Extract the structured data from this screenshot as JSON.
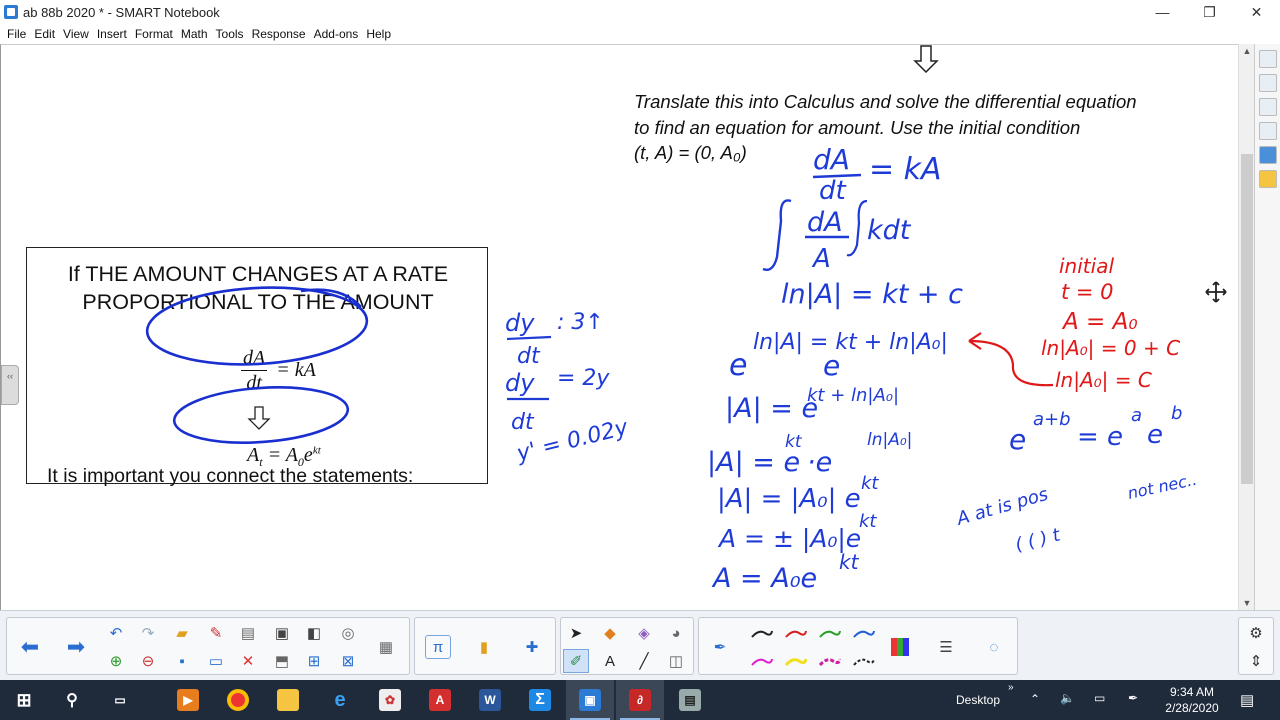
{
  "window": {
    "title": "ab 88b 2020 * - SMART Notebook",
    "minimize_glyph": "—",
    "restore_glyph": "❐",
    "close_glyph": "✕"
  },
  "menu": [
    "File",
    "Edit",
    "View",
    "Insert",
    "Format",
    "Math",
    "Tools",
    "Response",
    "Add-ons",
    "Help"
  ],
  "slide": {
    "box": {
      "title_line1": "If THE AMOUNT CHANGES AT A RATE",
      "title_line2": "PROPORTIONAL TO THE AMOUNT",
      "eq1_num": "dA",
      "eq1_den": "dt",
      "eq1_rhs": "= kA",
      "eq2_lhs": "A",
      "eq2_lhs_sub": "t",
      "eq2_mid": " = A",
      "eq2_mid_sub": "0",
      "eq2_base": "e",
      "eq2_exp": "kt"
    },
    "note": "It is important you connect the statements:",
    "instructions": {
      "line1": "Translate this into Calculus and solve the differential equation",
      "line2": "to find an equation for amount. Use the initial condition",
      "line3": "(t, A) = (0, A₀)"
    }
  },
  "ink": {
    "blue": {
      "l1": "dA",
      "l1b": "dt",
      "l1c": "= kA",
      "l2a": "dA",
      "l2b": "A",
      "l2c": "kdt",
      "l3": "ln|A| = kt + c",
      "l4": "e",
      "l4b": "ln|A| = kt + ln|A₀|",
      "l4c": "e",
      "l5": "|A| = e",
      "l5b": "kt + ln|A₀|",
      "l6": "|A| = e",
      "l6b": "kt",
      "l6c": "·e",
      "l6d": "ln|A₀|",
      "l7": "|A| = |A₀| e",
      "l7b": "kt",
      "l8": "A = ± |A₀|e",
      "l8b": "kt",
      "l9": "A = A₀e",
      "l9b": "kt",
      "m1": "dy",
      "m1b": "dt",
      "m1c": ": 3↑",
      "m2": "dy",
      "m2b": "dt",
      "m2c": "= 2y",
      "m3": "y' = 0.02y",
      "r1": "e",
      "r1b": "a+b",
      "r1c": "= e",
      "r1d": "a",
      "r1e": "e",
      "r1f": "b",
      "r2": "A at is pos",
      "r2b": "not nec..",
      "r2c": "( (  ) t"
    },
    "red": {
      "lines": [
        "initial",
        "t = 0",
        "A = A₀",
        "ln|A₀| = 0 + C",
        "ln|A₀| = C"
      ]
    }
  },
  "toolbar": {
    "pen_colors": [
      "#222222",
      "#d42020",
      "#2aa02a",
      "#2060d0",
      "#e020d0",
      "#f0e020",
      "#d020a0",
      "#222222"
    ]
  },
  "taskbar": {
    "desktop_label": "Desktop",
    "time": "9:34 AM",
    "date": "2/28/2020"
  },
  "colors": {
    "ink_blue": "#1f3bd6",
    "ink_red": "#e01818",
    "oval_blue": "#1a2fd0"
  }
}
